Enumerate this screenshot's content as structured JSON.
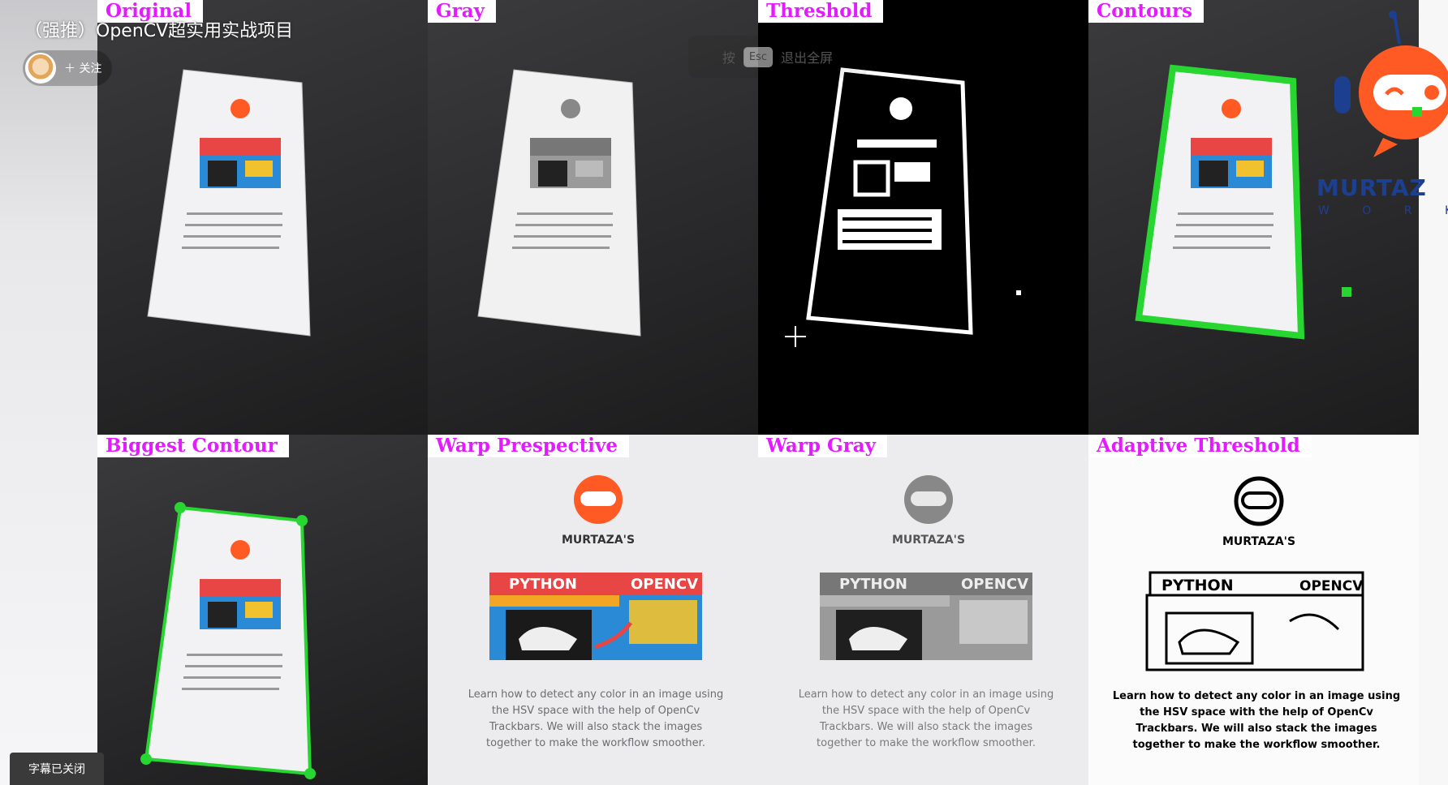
{
  "video": {
    "title": "（强推）OpenCV超实用实战项目",
    "follow_label": "＋ 关注"
  },
  "esc_hint": {
    "press": "按",
    "key": "Esc",
    "action": "退出全屏"
  },
  "subtitle_toggle": "字幕已关闭",
  "panels": {
    "original": "Original",
    "gray": "Gray",
    "threshold": "Threshold",
    "contours": "Contours",
    "biggest_contour": "Biggest Contour",
    "warp_perspective": "Warp Prespective",
    "warp_gray": "Warp Gray",
    "adaptive_threshold": "Adaptive Threshold"
  },
  "document": {
    "brand": "MURTAZA'S",
    "brand_sub": "WORKSHOP",
    "banner_left": "PYTHON",
    "banner_right": "OPENCV",
    "lines": [
      "Learn how to detect any color in an image using",
      "the HSV space with the help of OpenCv",
      "Trackbars. We will also stack the images",
      "together to make the workflow smoother."
    ]
  },
  "logo": {
    "text": "MURTAZ",
    "sub": "W O R K S"
  },
  "colors": {
    "label_magenta": "#e21cff",
    "contour_green": "#27d630",
    "logo_orange": "#ff5a24",
    "logo_blue": "#1d3f8f"
  }
}
